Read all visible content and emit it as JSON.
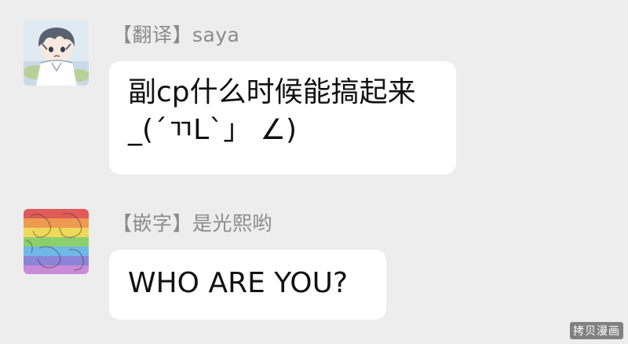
{
  "messages": [
    {
      "sender": "【翻译】saya",
      "lines": [
        "副cp什么时候能搞起来",
        "_(´ㄲL`」 ∠)"
      ]
    },
    {
      "sender": "【嵌字】是光熙哟",
      "lines": [
        "WHO ARE YOU?"
      ]
    }
  ],
  "watermark": "拷贝漫画",
  "colors": {
    "background": "#ededed",
    "bubble": "#ffffff",
    "sender_text": "#8b8b8b",
    "message_text": "#111111"
  }
}
